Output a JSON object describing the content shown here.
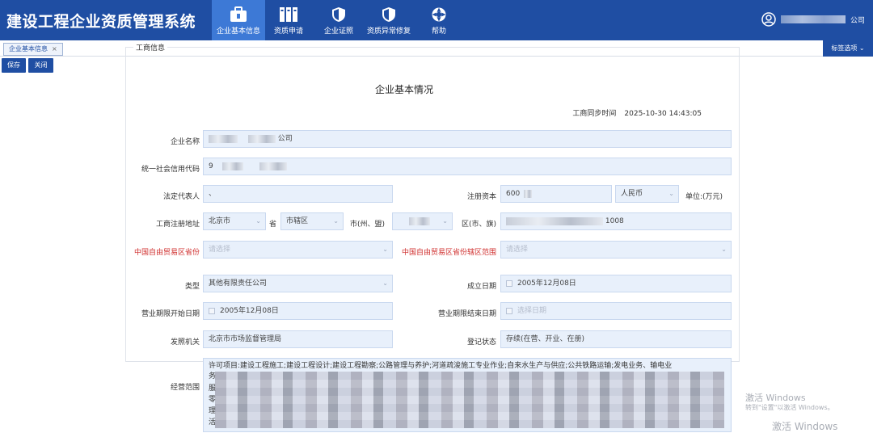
{
  "app": {
    "title": "建设工程企业资质管理系统"
  },
  "nav": [
    {
      "label": "企业基本信息",
      "icon": "briefcase-icon",
      "active": true
    },
    {
      "label": "资质申请",
      "icon": "documents-icon",
      "active": false
    },
    {
      "label": "企业证照",
      "icon": "shield-check-icon",
      "active": false
    },
    {
      "label": "资质异常修复",
      "icon": "shield-check-icon",
      "active": false
    },
    {
      "label": "帮助",
      "icon": "help-icon",
      "active": false
    }
  ],
  "user": {
    "name_suffix": "公司",
    "icon": "user-icon"
  },
  "tabs": {
    "active_label": "企业基本信息",
    "close": "×",
    "options_label": "标签选项 ⌄"
  },
  "toolbar": {
    "save_label": "保存",
    "close_label": "关闭"
  },
  "page": {
    "title": "企业基本情况",
    "sync_label": "工商同步时间",
    "sync_time": "2025-10-30 14:43:05",
    "section_label": "工商信息"
  },
  "form": {
    "company_name": {
      "label": "企业名称",
      "value_suffix": "公司"
    },
    "credit_code": {
      "label": "统一社会信用代码",
      "value_prefix": "9"
    },
    "legal_rep": {
      "label": "法定代表人",
      "value": "、"
    },
    "registered_capital": {
      "label": "注册资本",
      "value_prefix": "600",
      "currency": "人民币",
      "unit_label": "单位:(万元)"
    },
    "address": {
      "label": "工商注册地址",
      "province": "北京市",
      "province_suffix": "省",
      "city": "市辖区",
      "city_label": "市(州、盟)",
      "district_label": "区(市、旗)",
      "detail_suffix": "1008"
    },
    "ftz_province": {
      "label": "中国自由贸易区省份",
      "placeholder": "请选择"
    },
    "ftz_range": {
      "label": "中国自由贸易区省份辖区范围",
      "placeholder": "请选择"
    },
    "type": {
      "label": "类型",
      "value": "其他有限责任公司"
    },
    "established": {
      "label": "成立日期",
      "value": "2005年12月08日"
    },
    "term_start": {
      "label": "营业期限开始日期",
      "value": "2005年12月08日"
    },
    "term_end": {
      "label": "营业期限结束日期",
      "placeholder": "选择日期"
    },
    "authority": {
      "label": "发照机关",
      "value": "北京市市场监督管理局"
    },
    "status": {
      "label": "登记状态",
      "value": "存续(在营、开业、在册)"
    },
    "scope": {
      "label": "经营范围",
      "first_line": "许可项目:建设工程施工;建设工程设计;建设工程勘察;公路管理与养护;河道疏浚施工专业作业;自来水生产与供应;公共铁路运输;发电业务、输电业",
      "line_starts": [
        "务",
        "服",
        "零",
        "理",
        "活"
      ]
    }
  },
  "watermark": {
    "line1": "激活 Windows",
    "line2": "转到\"设置\"以激活 Windows。",
    "line3": "激活 Windows"
  }
}
